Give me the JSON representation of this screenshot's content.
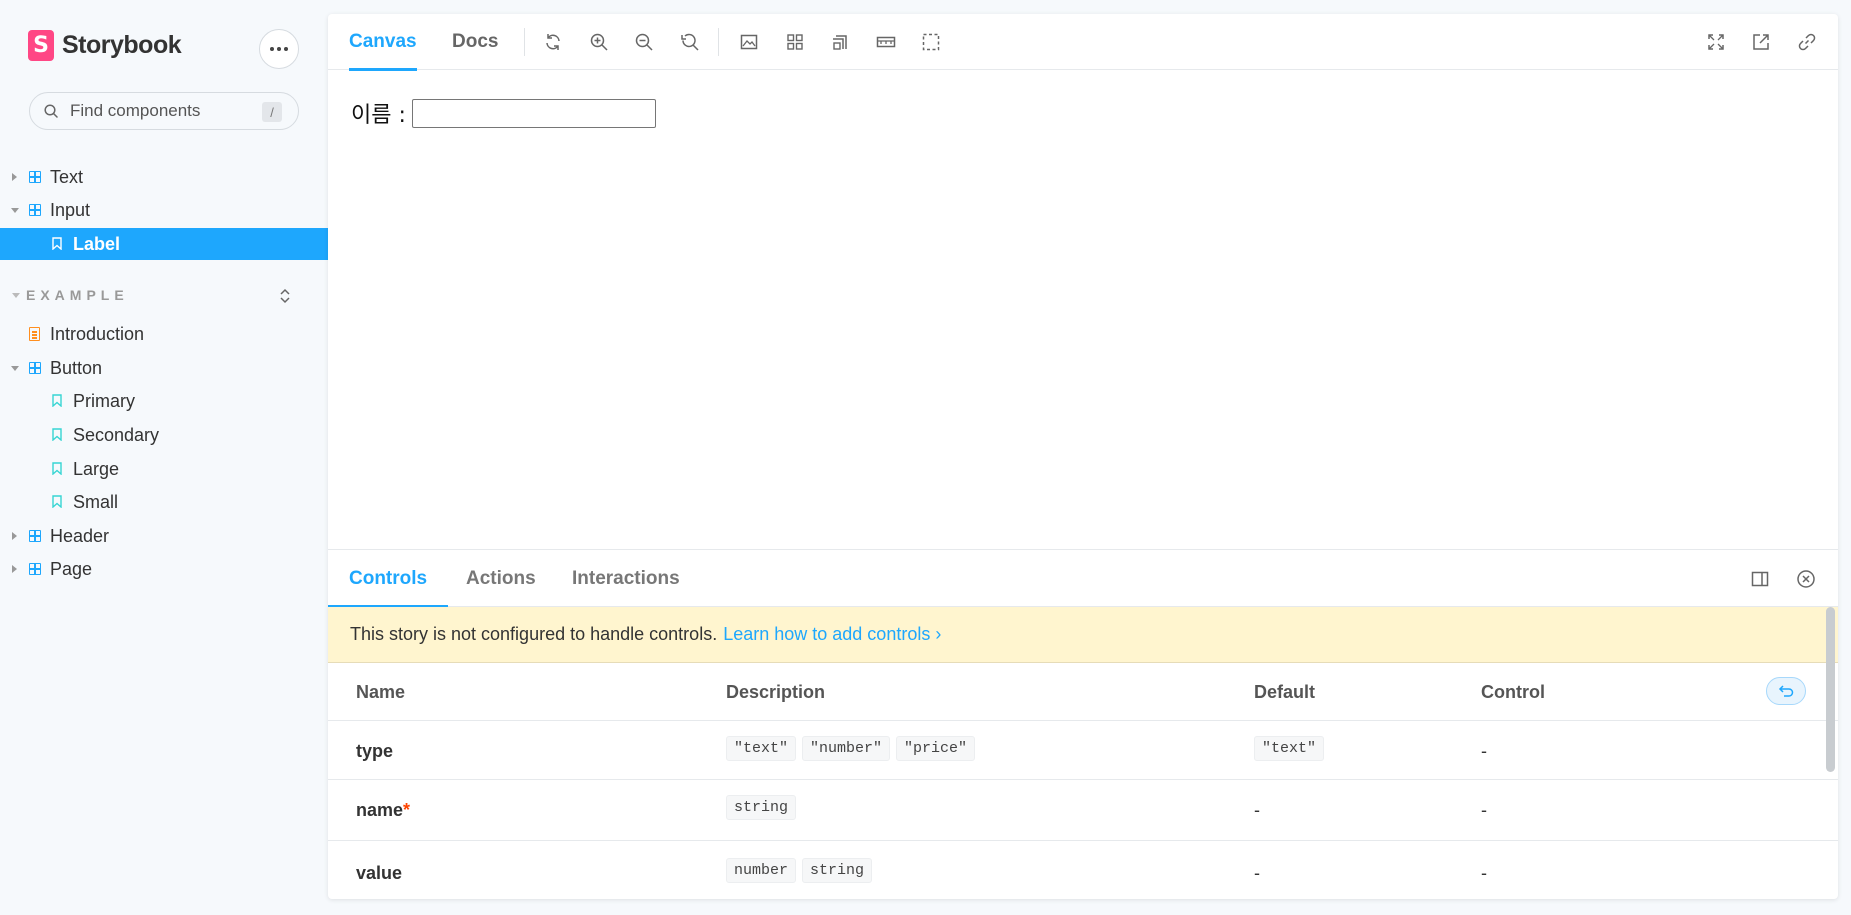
{
  "brand": {
    "logo_letter": "S",
    "name": "Storybook"
  },
  "search": {
    "placeholder": "Find components",
    "shortcut": "/"
  },
  "sidebar": {
    "tree": [
      {
        "label": "Text",
        "kind": "component",
        "expanded": false
      },
      {
        "label": "Input",
        "kind": "component",
        "expanded": true
      },
      {
        "label": "Label",
        "kind": "story",
        "selected": true
      }
    ],
    "section": {
      "title": "EXAMPLE"
    },
    "example_tree": [
      {
        "label": "Introduction",
        "kind": "docs"
      },
      {
        "label": "Button",
        "kind": "component",
        "expanded": true
      },
      {
        "label": "Primary",
        "kind": "story"
      },
      {
        "label": "Secondary",
        "kind": "story"
      },
      {
        "label": "Large",
        "kind": "story"
      },
      {
        "label": "Small",
        "kind": "story"
      },
      {
        "label": "Header",
        "kind": "component",
        "expanded": false
      },
      {
        "label": "Page",
        "kind": "component",
        "expanded": false
      }
    ]
  },
  "toolbar": {
    "tabs": [
      {
        "label": "Canvas",
        "active": true
      },
      {
        "label": "Docs",
        "active": false
      }
    ]
  },
  "canvas": {
    "field_label": "이름 :",
    "input_value": ""
  },
  "addons": {
    "tabs": [
      {
        "label": "Controls",
        "active": true
      },
      {
        "label": "Actions",
        "active": false
      },
      {
        "label": "Interactions",
        "active": false
      }
    ],
    "notice": {
      "text": "This story is not configured to handle controls.",
      "link": "Learn how to add controls ›"
    },
    "table": {
      "headers": {
        "name": "Name",
        "description": "Description",
        "default": "Default",
        "control": "Control"
      },
      "rows": [
        {
          "name": "type",
          "required": false,
          "description": [
            "\"text\"",
            "\"number\"",
            "\"price\""
          ],
          "default": "\"text\"",
          "control": "-"
        },
        {
          "name": "name",
          "required": true,
          "description": [
            "string"
          ],
          "default": "-",
          "control": "-"
        },
        {
          "name": "value",
          "required": false,
          "description": [
            "number",
            "string"
          ],
          "default": "-",
          "control": "-"
        }
      ],
      "required_marker": "*"
    }
  },
  "colors": {
    "accent": "#1ea7fd",
    "brand": "#ff4785",
    "notice_bg": "#fff5cf",
    "required": "#ff4400"
  }
}
